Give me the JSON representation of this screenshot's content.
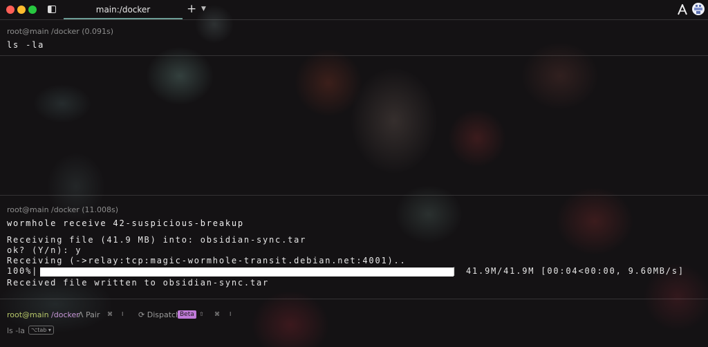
{
  "tab": {
    "title": "main:/docker"
  },
  "blocks": [
    {
      "header": "root@main /docker (0.091s)",
      "command": "ls -la",
      "output": []
    },
    {
      "header": "root@main /docker (11.008s)",
      "command": "wormhole receive 42-suspicious-breakup",
      "output": [
        "Receiving file (41.9 MB) into: obsidian-sync.tar",
        "ok? (Y/n): y",
        "Receiving (->relay:tcp:magic-wormhole-transit.debian.net:4001)..",
        "Received file written to obsidian-sync.tar"
      ],
      "progress": {
        "percent_label": "100%|",
        "fraction": 1.0,
        "end_cap": "|",
        "stats": "41.9M/41.9M [00:04<00:00, 9.60MB/s]"
      }
    }
  ],
  "prompt": {
    "user_host": "root@main",
    "path": "/docker",
    "pair_label": "Pair",
    "dispatch_label": "Dispatch",
    "beta_badge": "Beta",
    "input_text": "ls -la",
    "hint_label": "⌥tab ▾"
  },
  "icons": {
    "sidebar": "sidebar-toggle-icon",
    "new_tab": "plus-icon",
    "tab_menu": "chevron-down-icon",
    "warp": "warp-logo-icon",
    "avatar": "user-avatar"
  },
  "colors": {
    "tab_accent": "#6e9e97",
    "prompt_user": "#b8c96a",
    "prompt_path": "#c797d8",
    "beta_badge": "#c07ad9"
  }
}
